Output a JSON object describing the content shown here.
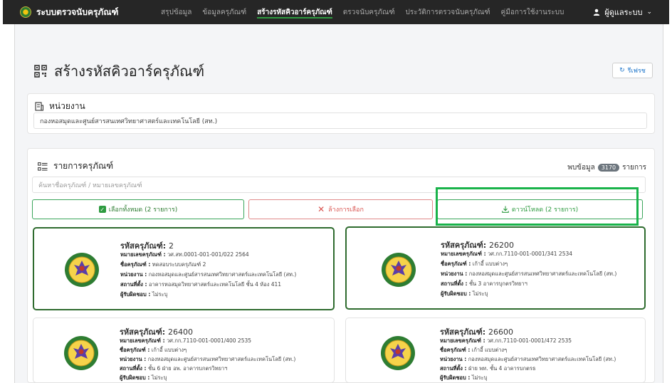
{
  "nav": {
    "brand": "ระบบตรวจนับครุภัณฑ์",
    "items": [
      "สรุปข้อมูล",
      "ข้อมูลครุภัณฑ์",
      "สร้างรหัสคิวอาร์ครุภัณฑ์",
      "ตรวจนับครุภัณฑ์",
      "ประวัติการตรวจนับครุภัณฑ์",
      "คู่มือการใช้งานระบบ"
    ],
    "active_index": 2,
    "user": "ผู้ดูแลระบบ"
  },
  "page": {
    "title": "สร้างรหัสคิวอาร์ครุภัณฑ์",
    "refresh": "รีเฟรช"
  },
  "agency": {
    "title": "หน่วยงาน",
    "value": "กองหอสมุดและศูนย์สารสนเทศวิทยาศาสตร์และเทคโนโลยี (สท.)"
  },
  "list": {
    "title": "รายการครุภัณฑ์",
    "found_label": "พบข้อมูล",
    "found_count": "3170",
    "found_unit": "รายการ",
    "search_placeholder": "ค้นหาชื่อครุภัณฑ์ / หมายเลขครุภัณฑ์",
    "select_all": "เลือกทั้งหมด (2 รายการ)",
    "clear": "ล้างการเลือก",
    "download": "ดาวน์โหลด (2 รายการ)"
  },
  "field_labels": {
    "code": "รหัสครุภัณฑ์:",
    "number": "หมายเลขครุภัณฑ์ :",
    "name": "ชื่อครุภัณฑ์ :",
    "unit": "หน่วยงาน :",
    "location": "สถานที่ตั้ง :",
    "owner": "ผู้รับผิดชอบ :"
  },
  "assets": [
    {
      "code": "2",
      "number": "วศ.สท.0001-001-001/022 2564",
      "name": "ทดสอบระบบครุภัณฑ์ 2",
      "unit": "กองหอสมุดและศูนย์สารสนเทศวิทยาศาสตร์และเทคโนโลยี (สท.)",
      "location": "อาคารหอสมุดวิทยาศาสตร์และเทคโนโลยี ชั้น 4 ห้อง 411",
      "owner": "ไม่ระบุ",
      "selected": true
    },
    {
      "code": "26200",
      "number": "วศ.กก.7110-001-0001/341 2534",
      "name": "เก้าอี้ แบบต่างๆ",
      "unit": "กองหอสมุดและศูนย์สารสนเทศวิทยาศาสตร์และเทคโนโลยี (สท.)",
      "location": "ชั้น 3 อาคารบุกตรวิทยาฯ",
      "owner": "ไม่ระบุ",
      "selected": true
    },
    {
      "code": "26400",
      "number": "วศ.กก.7110-001-0001/400 2535",
      "name": "เก้าอี้ แบบต่างๆ",
      "unit": "กองหอสมุดและศูนย์สารสนเทศวิทยาศาสตร์และเทคโนโลยี (สท.)",
      "location": "ชั้น 6 ฝ่าย อพ. อาคารบกตรวิทยาฯ",
      "owner": "ไม่ระบุ",
      "selected": false
    },
    {
      "code": "26600",
      "number": "วศ.กก.7110-001-0001/472 2535",
      "name": "เก้าอี้ แบบต่างๆ",
      "unit": "กองหอสมุดและศูนย์สารสนเทศวิทยาศาสตร์และเทคโนโลยี (สท.)",
      "location": "ฝ่าย พท. ชั้น 4 อาคารบกตรธ",
      "owner": "ไม่ระบุ",
      "selected": false
    }
  ],
  "colors": {
    "navbar": "#262626",
    "accent_green": "#2e9b40",
    "highlight_box": "#19b34a",
    "danger": "#d9534f",
    "link_blue": "#1a73c9"
  },
  "icons": [
    "qr-code-icon",
    "building-icon",
    "list-icon",
    "user-icon",
    "refresh-icon",
    "download-icon",
    "check-icon",
    "close-icon"
  ]
}
